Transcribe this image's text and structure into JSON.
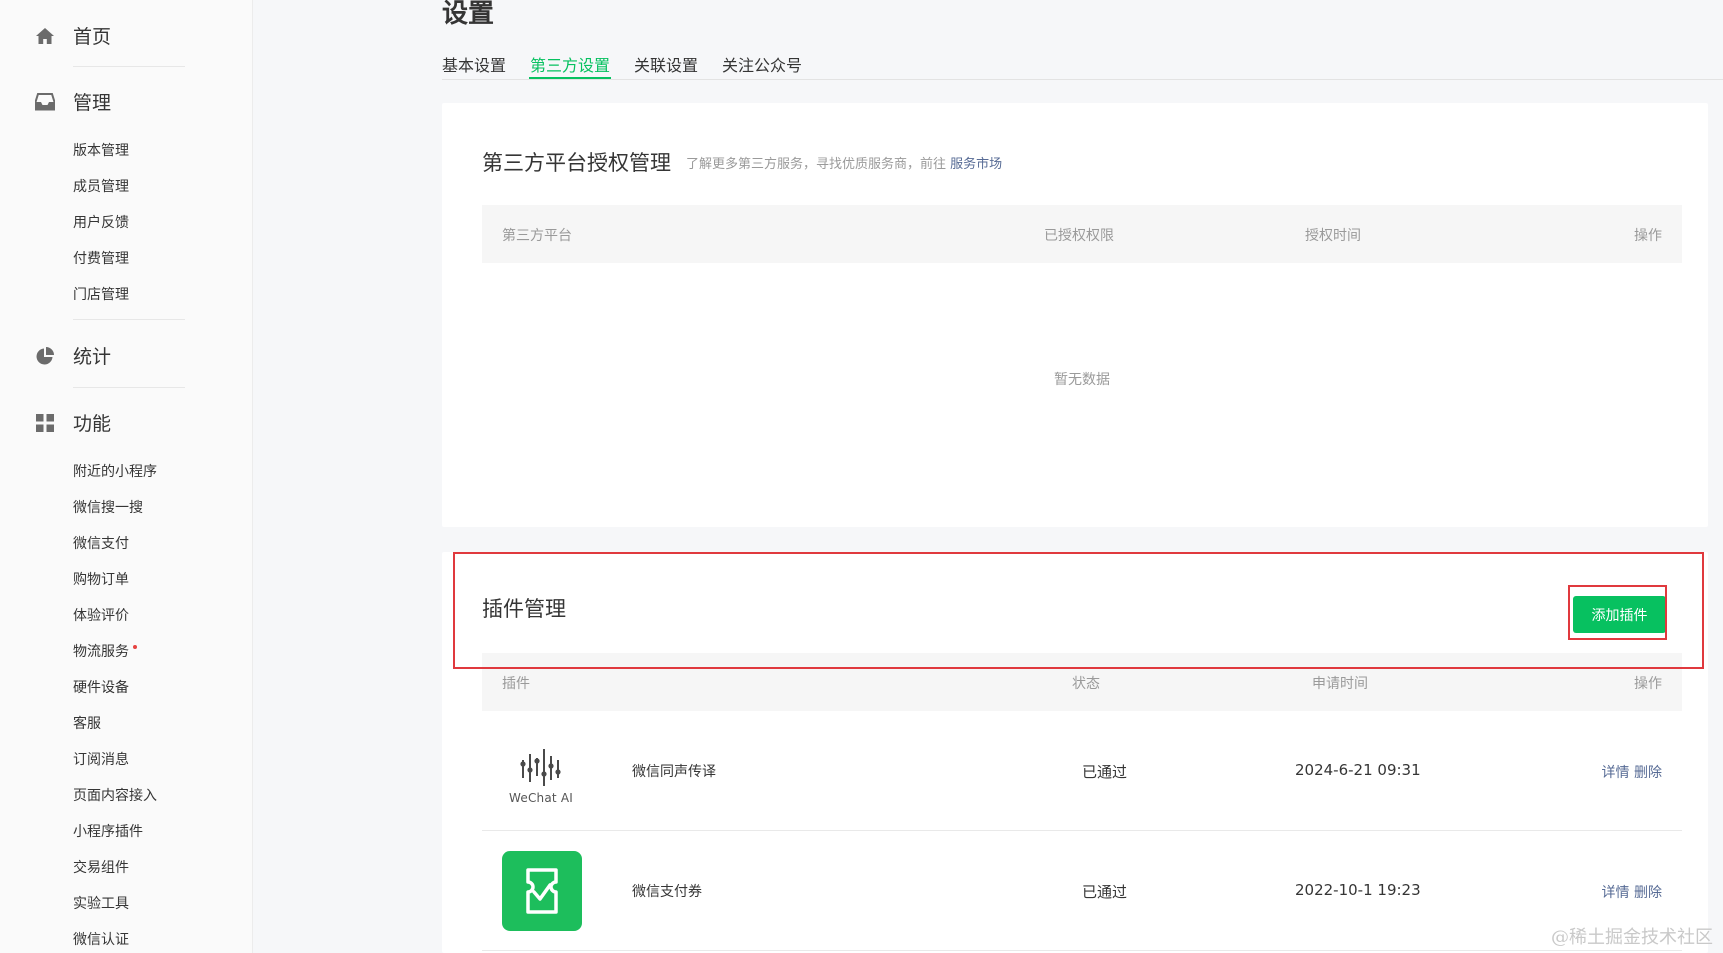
{
  "sidebar": {
    "groups": [
      {
        "icon": "home-icon",
        "label": "首页"
      },
      {
        "icon": "inbox-icon",
        "label": "管理",
        "items": [
          "版本管理",
          "成员管理",
          "用户反馈",
          "付费管理",
          "门店管理"
        ]
      },
      {
        "icon": "pie-chart-icon",
        "label": "统计"
      },
      {
        "icon": "grid-icon",
        "label": "功能",
        "items": [
          "附近的小程序",
          "微信搜一搜",
          "微信支付",
          "购物订单",
          "体验评价",
          "物流服务",
          "硬件设备",
          "客服",
          "订阅消息",
          "页面内容接入",
          "小程序插件",
          "交易组件",
          "实验工具",
          "微信认证"
        ]
      }
    ]
  },
  "page": {
    "title": "设置"
  },
  "tabs": [
    "基本设置",
    "第三方设置",
    "关联设置",
    "关注公众号"
  ],
  "active_tab": "第三方设置",
  "third_party": {
    "title": "第三方平台授权管理",
    "desc": "了解更多第三方服务，寻找优质服务商，前往",
    "desc_link": "服务市场",
    "columns": [
      "第三方平台",
      "已授权权限",
      "授权时间",
      "操作"
    ],
    "empty_text": "暂无数据"
  },
  "plugins": {
    "title": "插件管理",
    "add_button": "添加插件",
    "columns": [
      "插件",
      "状态",
      "申请时间",
      "操作"
    ],
    "rows": [
      {
        "logo": "WeChat AI",
        "name": "微信同声传译",
        "status": "已通过",
        "time": "2024-6-21 09:31",
        "detail": "详情",
        "delete": "删除"
      },
      {
        "logo": "coupon-logo",
        "name": "微信支付券",
        "status": "已通过",
        "time": "2022-10-1 19:23",
        "detail": "详情",
        "delete": "删除"
      }
    ]
  },
  "watermark": "@稀土掘金技术社区",
  "colors": {
    "accent": "#07c160",
    "link": "#576b95",
    "highlight": "#e0393e"
  }
}
